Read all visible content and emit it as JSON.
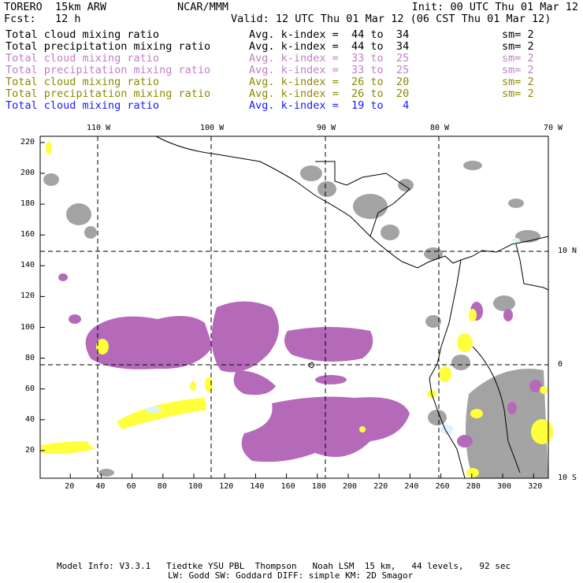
{
  "header": {
    "model": "TORERO  15km ARW",
    "org": "NCAR/MMM",
    "init": "Init: 00 UTC Thu 01 Mar 12",
    "fcst": "Fcst:   12 h",
    "valid": "Valid: 12 UTC Thu 01 Mar 12 (06 CST Thu 01 Mar 12)"
  },
  "legend": [
    {
      "field": "Total cloud mixing ratio",
      "range": "Avg. k-index =  44 to  34",
      "sm": "sm= 2",
      "color": "#000000"
    },
    {
      "field": "Total precipitation mixing ratio",
      "range": "Avg. k-index =  44 to  34",
      "sm": "sm= 2",
      "color": "#000000"
    },
    {
      "field": "Total cloud mixing ratio",
      "range": "Avg. k-index =  33 to  25",
      "sm": "sm= 2",
      "color": "#c27fc6"
    },
    {
      "field": "Total precipitation mixing ratio",
      "range": "Avg. k-index =  33 to  25",
      "sm": "sm= 2",
      "color": "#c27fc6"
    },
    {
      "field": "Total cloud mixing ratio",
      "range": "Avg. k-index =  26 to  20",
      "sm": "sm= 2",
      "color": "#8c8a00"
    },
    {
      "field": "Total precipitation mixing ratio",
      "range": "Avg. k-index =  26 to  20",
      "sm": "sm= 2",
      "color": "#8c8a00"
    },
    {
      "field": "Total cloud mixing ratio",
      "range": "Avg. k-index =  19 to   4",
      "color": "#1a1aff"
    }
  ],
  "map": {
    "lon_labels": [
      "110 W",
      "100 W",
      "90 W",
      "80 W",
      "70 W"
    ],
    "lat_labels": [
      "10 N",
      "0",
      "10 S"
    ],
    "x_ticks": [
      "20",
      "40",
      "60",
      "80",
      "100",
      "120",
      "140",
      "160",
      "180",
      "200",
      "220",
      "240",
      "260",
      "280",
      "300",
      "320"
    ],
    "y_ticks": [
      "20",
      "40",
      "60",
      "80",
      "100",
      "120",
      "140",
      "160",
      "180",
      "200",
      "220"
    ],
    "colors": {
      "gray": "#9a9a9a",
      "purple": "#b56ab9",
      "yellow": "#ffff3c",
      "cyan": "#d8f4f8"
    }
  },
  "footer": {
    "line1": "Model Info: V3.3.1   Tiedtke YSU PBL  Thompson   Noah LSM  15 km,   44 levels,   92 sec",
    "line2": "LW: Godd SW: Goddard DIFF: simple KM: 2D Smagor"
  }
}
